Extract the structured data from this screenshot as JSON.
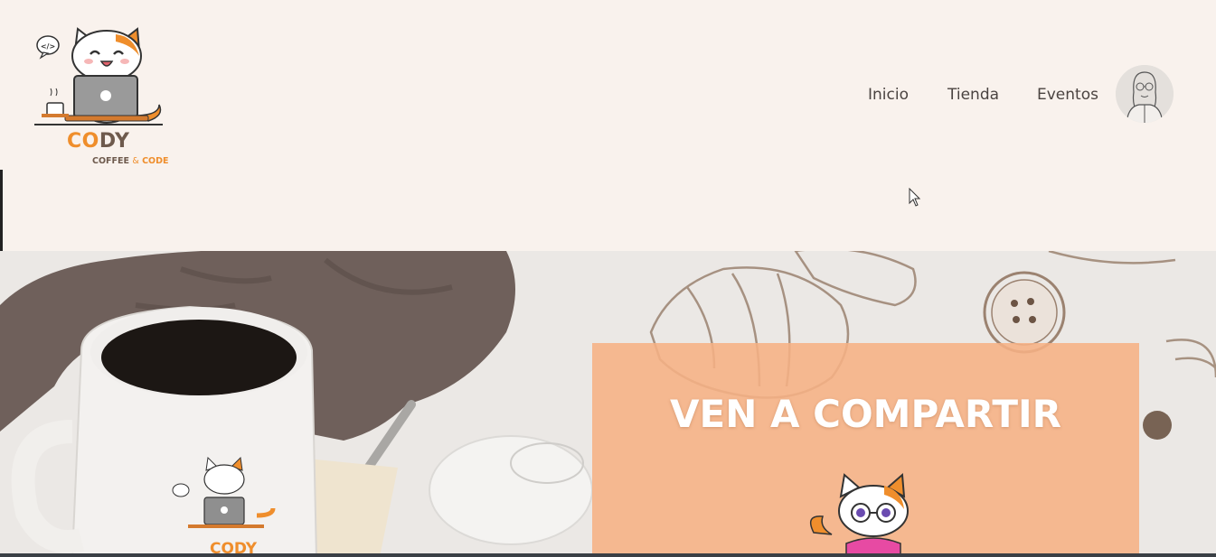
{
  "brand": {
    "name_part1": "CO",
    "name_part2": "DY",
    "tagline_part1": "COFFEE",
    "tagline_amp": "&",
    "tagline_part2": "CODE",
    "code_bubble": "</>"
  },
  "nav": {
    "items": [
      {
        "label": "Inicio"
      },
      {
        "label": "Tienda"
      },
      {
        "label": "Eventos"
      }
    ]
  },
  "hero": {
    "promo_title": "VEN A COMPARTIR",
    "mug_brand": "CODY"
  },
  "colors": {
    "background": "#f9f2ed",
    "accent_orange": "#ef8e2c",
    "brand_brown": "#6e5a4d",
    "promo_panel": "#f6b184",
    "nav_text": "#4a4340"
  },
  "icons": {
    "logo": "cat-with-laptop-logo",
    "avatar": "user-avatar-sketch",
    "cursor": "mouse-cursor-icon"
  }
}
